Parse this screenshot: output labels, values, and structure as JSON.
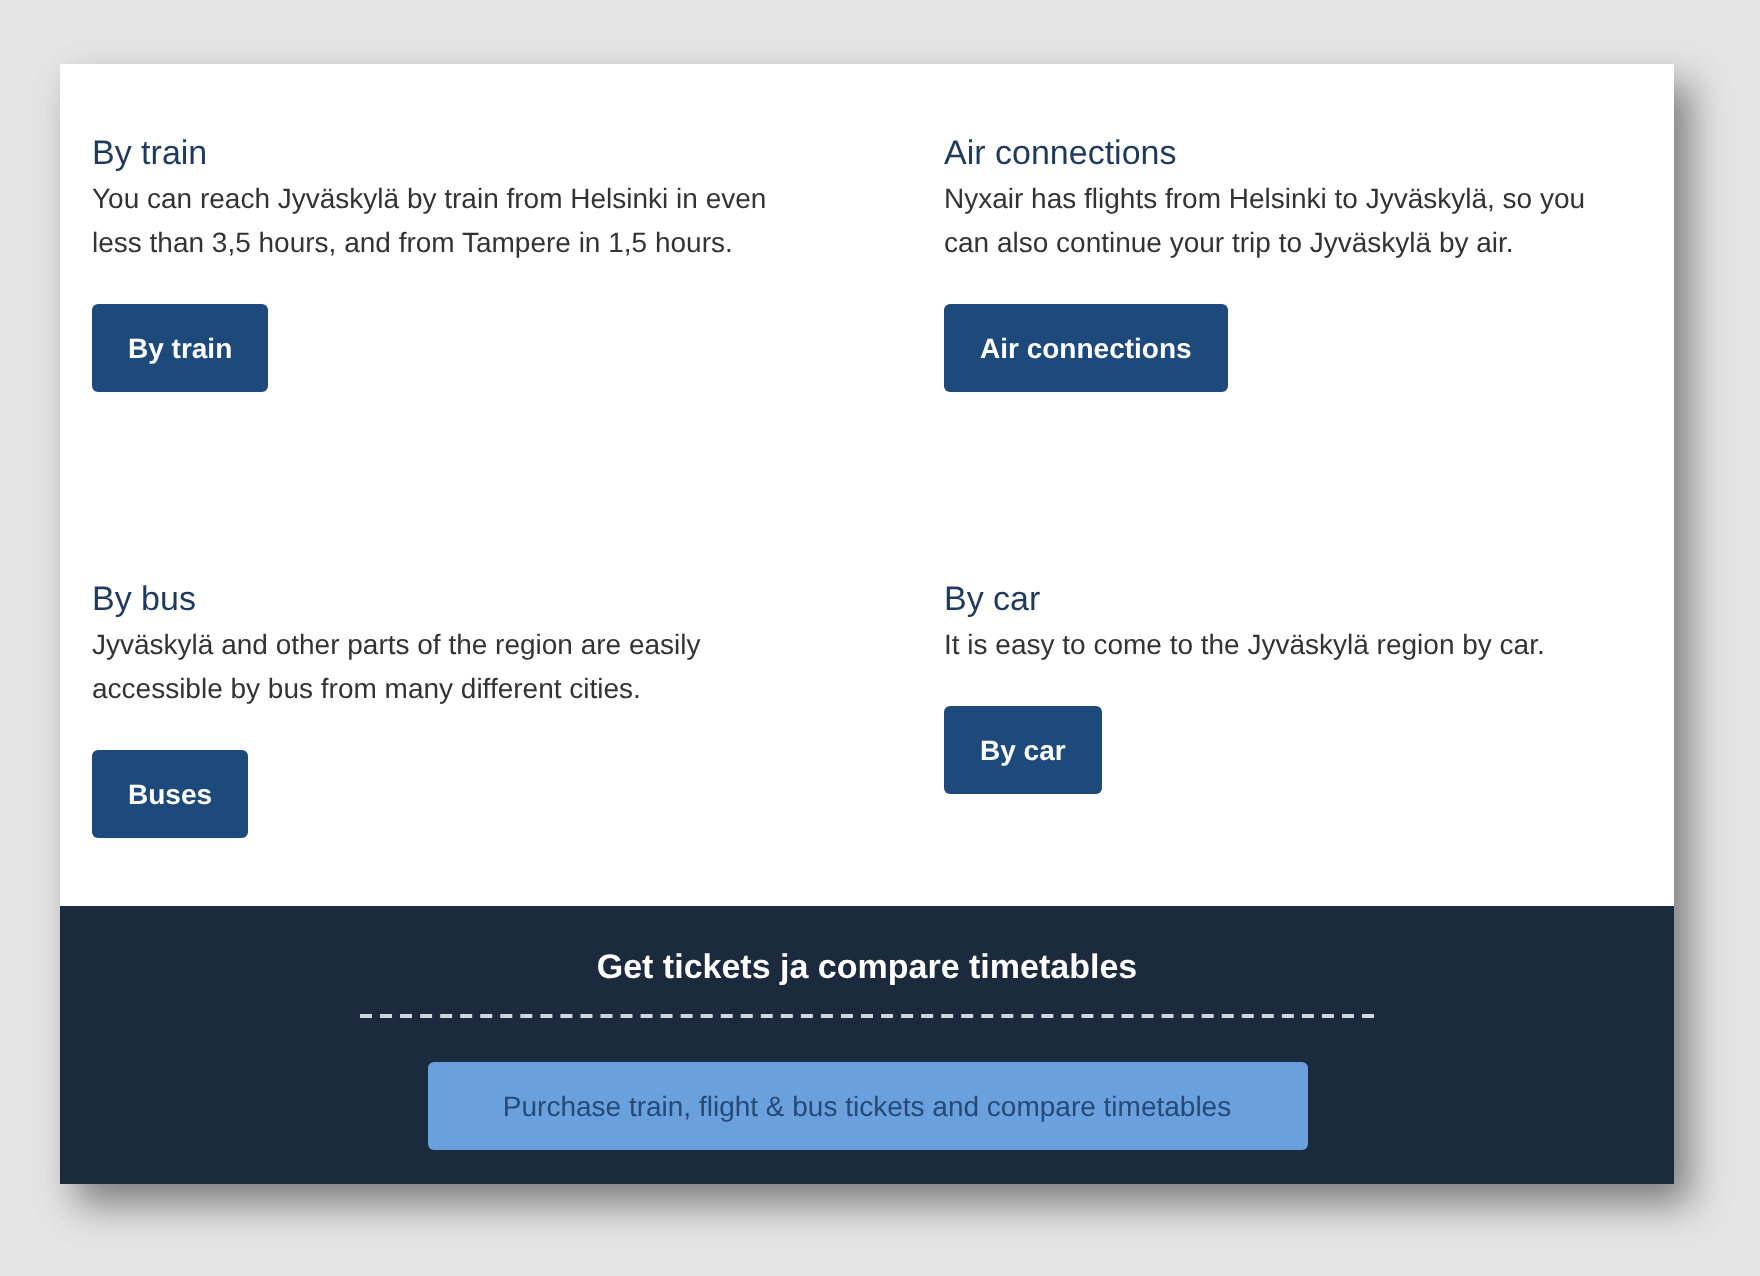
{
  "sections": [
    {
      "title": "By train",
      "text": "You can reach Jyväskylä by train from Helsinki in even less than 3,5 hours, and from Tampere in 1,5 hours.",
      "button": "By train"
    },
    {
      "title": "Air connections",
      "text": "Nyxair has flights from Helsinki to Jyväskylä, so you can also continue your trip to Jyväskylä by air.",
      "button": "Air connections"
    },
    {
      "title": "By bus",
      "text": "Jyväskylä and other parts of the region are easily accessible by bus from many different cities.",
      "button": "Buses"
    },
    {
      "title": "By car",
      "text": "It is easy to come to the Jyväskylä region by car.",
      "button": "By car"
    }
  ],
  "footer": {
    "title": "Get tickets ja compare timetables",
    "button": "Purchase train, flight & bus tickets and compare timetables"
  }
}
